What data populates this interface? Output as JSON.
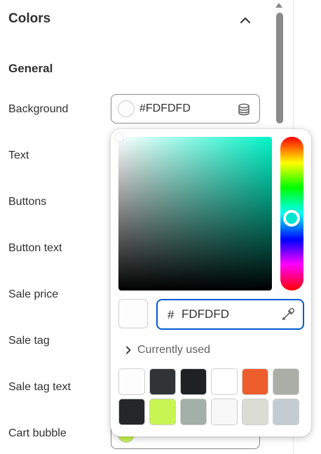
{
  "panel": {
    "title": "Colors",
    "group_title": "General",
    "fields": [
      {
        "label": "Background"
      },
      {
        "label": "Text"
      },
      {
        "label": "Buttons"
      },
      {
        "label": "Button text"
      },
      {
        "label": "Sale price"
      },
      {
        "label": "Sale tag"
      },
      {
        "label": "Sale tag text"
      },
      {
        "label": "Cart bubble"
      }
    ],
    "background_value": "#FDFDFD",
    "background_color": "#FDFDFD",
    "cart_bubble_color": "#C8F550"
  },
  "picker": {
    "hash": "#",
    "hex_value": "FDFDFD",
    "preview_color": "#FDFDFD",
    "currently_used_label": "Currently used",
    "swatches": [
      "#FDFDFD",
      "#303436",
      "#1E2222",
      "#FFFFFF",
      "#EE5E2C",
      "#ABAEA6",
      "#232728",
      "#C9F552",
      "#A3B0A7",
      "#F8F8F8",
      "#DBDDD4",
      "#C4CCD1"
    ]
  },
  "icons": {
    "collapse": "chevron-up-icon",
    "database": "database-icon",
    "eyedropper": "eyedropper-icon",
    "expand": "chevron-right-icon"
  }
}
